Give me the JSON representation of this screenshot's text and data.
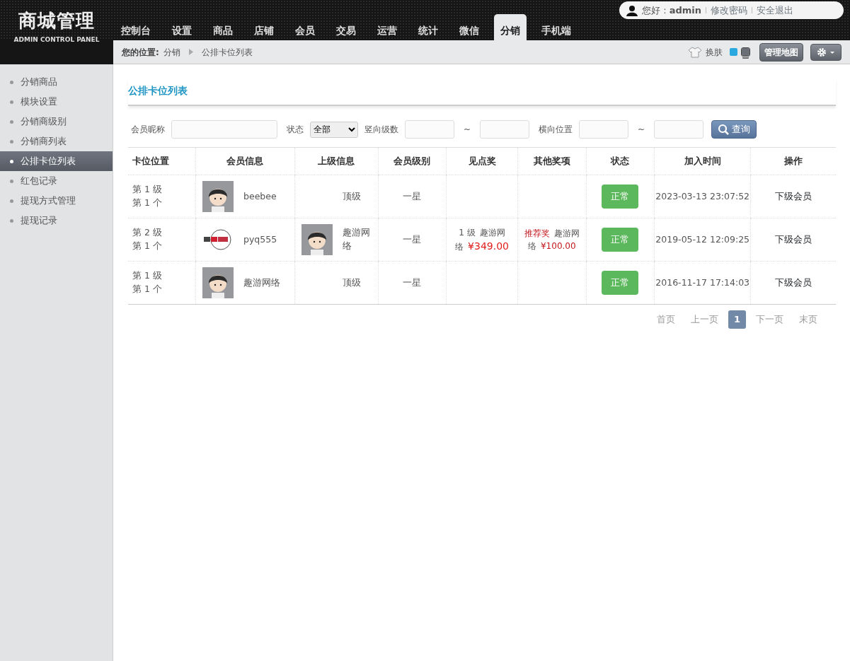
{
  "logo": {
    "title": "商城管理",
    "subtitle": "ADMIN CONTROL PANEL"
  },
  "nav": [
    {
      "label": "控制台",
      "selected": false
    },
    {
      "label": "设置",
      "selected": false
    },
    {
      "label": "商品",
      "selected": false
    },
    {
      "label": "店铺",
      "selected": false
    },
    {
      "label": "会员",
      "selected": false
    },
    {
      "label": "交易",
      "selected": false
    },
    {
      "label": "运营",
      "selected": false
    },
    {
      "label": "统计",
      "selected": false
    },
    {
      "label": "微信",
      "selected": false
    },
    {
      "label": "分销",
      "selected": true
    },
    {
      "label": "手机端",
      "selected": false
    }
  ],
  "user_bar": {
    "greeting": "您好 : ",
    "username": "admin",
    "links": [
      "修改密码",
      "安全退出"
    ]
  },
  "breadcrumb": {
    "label": "您的位置:",
    "items": [
      "分销",
      "公排卡位列表"
    ]
  },
  "toolbar": {
    "skin_label": "换肤",
    "skins": [
      {
        "color": "#29a9e0",
        "selected": false
      },
      {
        "color": "#6b6f76",
        "selected": true
      }
    ],
    "map_button": "管理地图"
  },
  "sidebar": {
    "items": [
      {
        "label": "分销商品",
        "selected": false
      },
      {
        "label": "模块设置",
        "selected": false
      },
      {
        "label": "分销商级别",
        "selected": false
      },
      {
        "label": "分销商列表",
        "selected": false
      },
      {
        "label": "公排卡位列表",
        "selected": true
      },
      {
        "label": "红包记录",
        "selected": false
      },
      {
        "label": "提现方式管理",
        "selected": false
      },
      {
        "label": "提现记录",
        "selected": false
      }
    ]
  },
  "page_title": "公排卡位列表",
  "filters": {
    "nickname_label": "会员昵称",
    "status_label": "状态",
    "status_value": "全部",
    "vertical_label": "竖向级数",
    "horizontal_label": "横向位置",
    "range_sep": "~",
    "search_button": "查询"
  },
  "table": {
    "columns": [
      "卡位位置",
      "会员信息",
      "上级信息",
      "会员级别",
      "见点奖",
      "其他奖项",
      "状态",
      "加入时间",
      "操作"
    ],
    "rows": [
      {
        "position": [
          "第 1 级",
          "第 1 个"
        ],
        "member": {
          "kind": "avatar",
          "name": "beebee"
        },
        "parent": {
          "kind": "none",
          "name": "顶级"
        },
        "level": "一星",
        "point_award": null,
        "other_award": null,
        "status": "正常",
        "joined": "2023-03-13 23:07:52",
        "action": "下级会员"
      },
      {
        "position": [
          "第 2 级",
          "第 1 个"
        ],
        "member": {
          "kind": "logo",
          "name": "pyq555"
        },
        "parent": {
          "kind": "avatar",
          "name": "趣游网络"
        },
        "level": "一星",
        "point_award": {
          "prefix": "1 级",
          "name": "趣游网络",
          "amount": "¥349.00"
        },
        "other_award": {
          "prefix": "推荐奖",
          "name": "趣游网络",
          "amount": "¥100.00"
        },
        "status": "正常",
        "joined": "2019-05-12 12:09:25",
        "action": "下级会员"
      },
      {
        "position": [
          "第 1 级",
          "第 1 个"
        ],
        "member": {
          "kind": "avatar",
          "name": "趣游网络"
        },
        "parent": {
          "kind": "none",
          "name": "顶级"
        },
        "level": "一星",
        "point_award": null,
        "other_award": null,
        "status": "正常",
        "joined": "2016-11-17 17:14:03",
        "action": "下级会员"
      }
    ]
  },
  "pagination": [
    {
      "label": "首页",
      "selected": false
    },
    {
      "label": "上一页",
      "selected": false
    },
    {
      "label": "1",
      "selected": true
    },
    {
      "label": "下一页",
      "selected": false
    },
    {
      "label": "末页",
      "selected": false
    }
  ]
}
